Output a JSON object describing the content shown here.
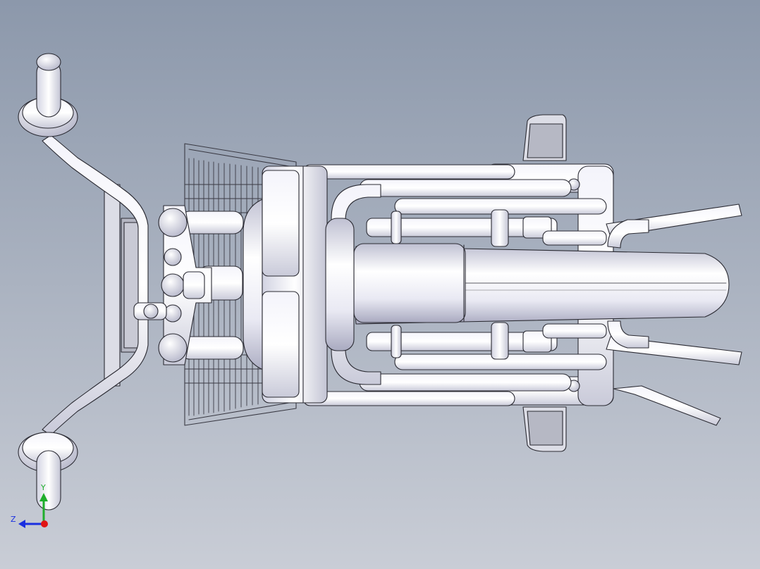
{
  "viewport": {
    "background_top": "#8c98ab",
    "background_bottom": "#c9cdd6",
    "model": "motorcycle-top-view"
  },
  "triad": {
    "y_label": "Y",
    "z_label": "Z",
    "y_color": "#1fae2c",
    "z_color": "#1a2fe0",
    "x_color": "#e01414"
  }
}
